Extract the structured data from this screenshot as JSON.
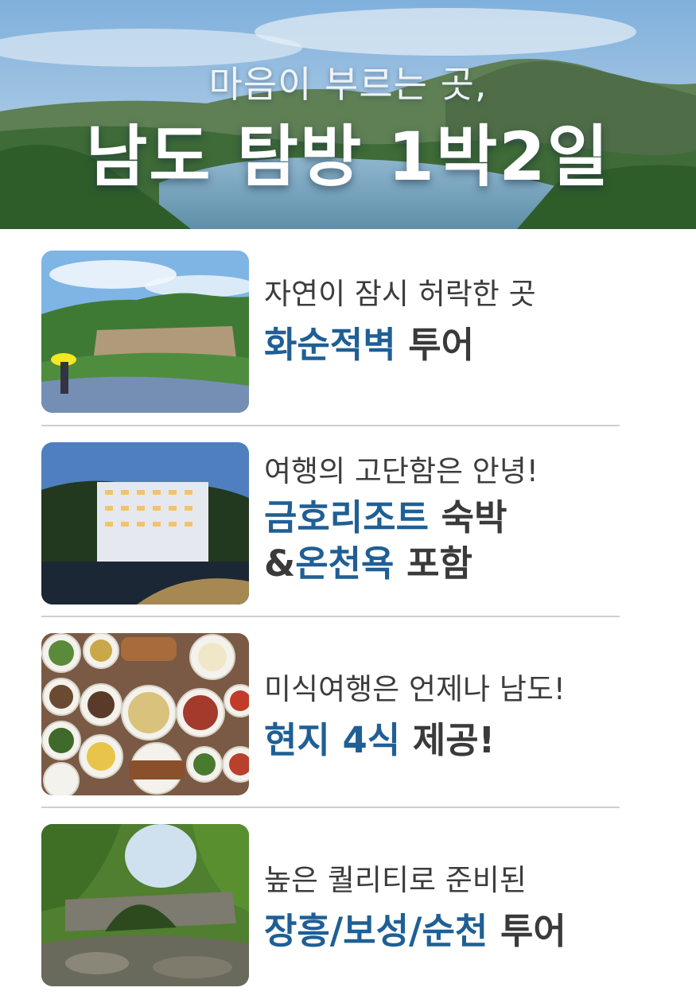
{
  "hero": {
    "subtitle": "마음이 부르는 곳,",
    "title": "남도 탐방 1박2일"
  },
  "items": [
    {
      "subtitle": "자연이 잠시 허락한 곳",
      "line1_highlight": "화순적벽",
      "line1_rest": " 투어",
      "photo": "mountain-cliff-with-hydrangea-and-yellow-umbrella"
    },
    {
      "subtitle": "여행의 고단함은 안녕!",
      "line1_highlight": "금호리조트",
      "line1_rest": " 숙박",
      "line2_prefix": "&",
      "line2_highlight": "온천욕",
      "line2_rest": " 포함",
      "photo": "resort-hotel-at-dusk"
    },
    {
      "subtitle": "미식여행은 언제나 남도!",
      "line1_highlight": "현지 4식",
      "line1_rest": " 제공!",
      "photo": "korean-table-spread-with-side-dishes"
    },
    {
      "subtitle": "높은 퀄리티로 준비된",
      "line1_highlight": "장흥/보성/순천",
      "line1_rest": " 투어",
      "photo": "stone-arch-bridge-in-forest"
    }
  ],
  "colors": {
    "highlight": "#1f5f95",
    "text": "#3a3a3a",
    "divider": "#cfcfcf"
  }
}
